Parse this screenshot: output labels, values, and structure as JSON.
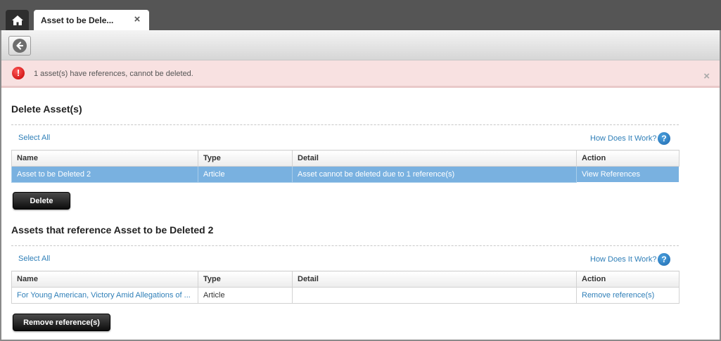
{
  "tabs": {
    "home_icon": "home-icon",
    "active_tab_label": "Asset to be Dele...",
    "close_icon": "×"
  },
  "toolbar": {
    "back_icon": "back-arrow-icon"
  },
  "alert": {
    "icon": "!",
    "message": "1 asset(s) have references, cannot be deleted.",
    "close": "×"
  },
  "delete_section": {
    "title": "Delete Asset(s)",
    "select_all": "Select All",
    "how_link": "How Does It Work?",
    "help_icon": "?",
    "columns": [
      "Name",
      "Type",
      "Detail",
      "Action"
    ],
    "rows": [
      {
        "name": "Asset to be Deleted 2",
        "type": "Article",
        "detail": "Asset cannot be deleted due to 1 reference(s)",
        "action": "View References"
      }
    ],
    "button_label": "Delete"
  },
  "refs_section": {
    "title": "Assets that reference Asset to be Deleted 2",
    "select_all": "Select All",
    "how_link": "How Does It Work?",
    "help_icon": "?",
    "columns": [
      "Name",
      "Type",
      "Detail",
      "Action"
    ],
    "rows": [
      {
        "name": "For Young American, Victory Amid Allegations of ...",
        "type": "Article",
        "detail": "",
        "action": "Remove reference(s)"
      }
    ],
    "button_label": "Remove reference(s)"
  },
  "colors": {
    "selected_row": "#79b1e0",
    "link": "#2f7fb8",
    "alert_bg": "#f8e1e1"
  }
}
